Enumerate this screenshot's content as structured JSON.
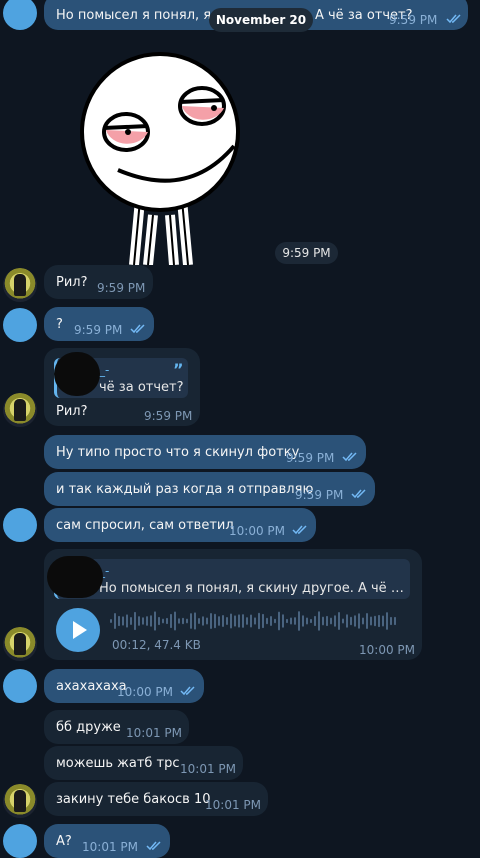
{
  "date_divider": "November 20",
  "sticker_time": "9:59 PM",
  "messages": {
    "m0": {
      "text": "Но помысел я понял, я скину другое.  А чё за отчет?",
      "time": "9:59 PM"
    },
    "m1": {
      "text": "Рил?",
      "time": "9:59 PM"
    },
    "m2": {
      "text": "?",
      "time": "9:59 PM"
    },
    "m3": {
      "reply_name": "_-",
      "reply_text": "чё за отчет?",
      "text": "Рил?",
      "time": "9:59 PM"
    },
    "m4": {
      "text": "Ну типо просто что я скинул фотку",
      "time": "9:59 PM"
    },
    "m5": {
      "text": "и так каждый раз когда я отправляю",
      "time": "9:59 PM"
    },
    "m6": {
      "text": "сам  спросил, сам ответил",
      "time": "10:00 PM"
    },
    "m7": {
      "reply_name": "_-",
      "reply_text": "Но помысел я понял, я скину другое.  А чё за от...",
      "voice_meta": "00:12, 47.4 KB",
      "time": "10:00 PM"
    },
    "m8": {
      "text": "ахахахаха",
      "time": "10:00 PM"
    },
    "m9": {
      "text": "бб друже",
      "time": "10:01 PM"
    },
    "m10": {
      "text": "можешь жатб трс",
      "time": "10:01 PM"
    },
    "m11": {
      "text": "закину тебе бакосв 10",
      "time": "10:01 PM"
    },
    "m12": {
      "text": "А?",
      "time": "10:01 PM"
    }
  },
  "icons": {
    "read": "double-check-icon",
    "play": "play-icon",
    "quote": "quote-icon"
  },
  "colors": {
    "background": "#0e1621",
    "incoming": "#182533",
    "outgoing": "#2b5278",
    "accent": "#64b5ef"
  }
}
